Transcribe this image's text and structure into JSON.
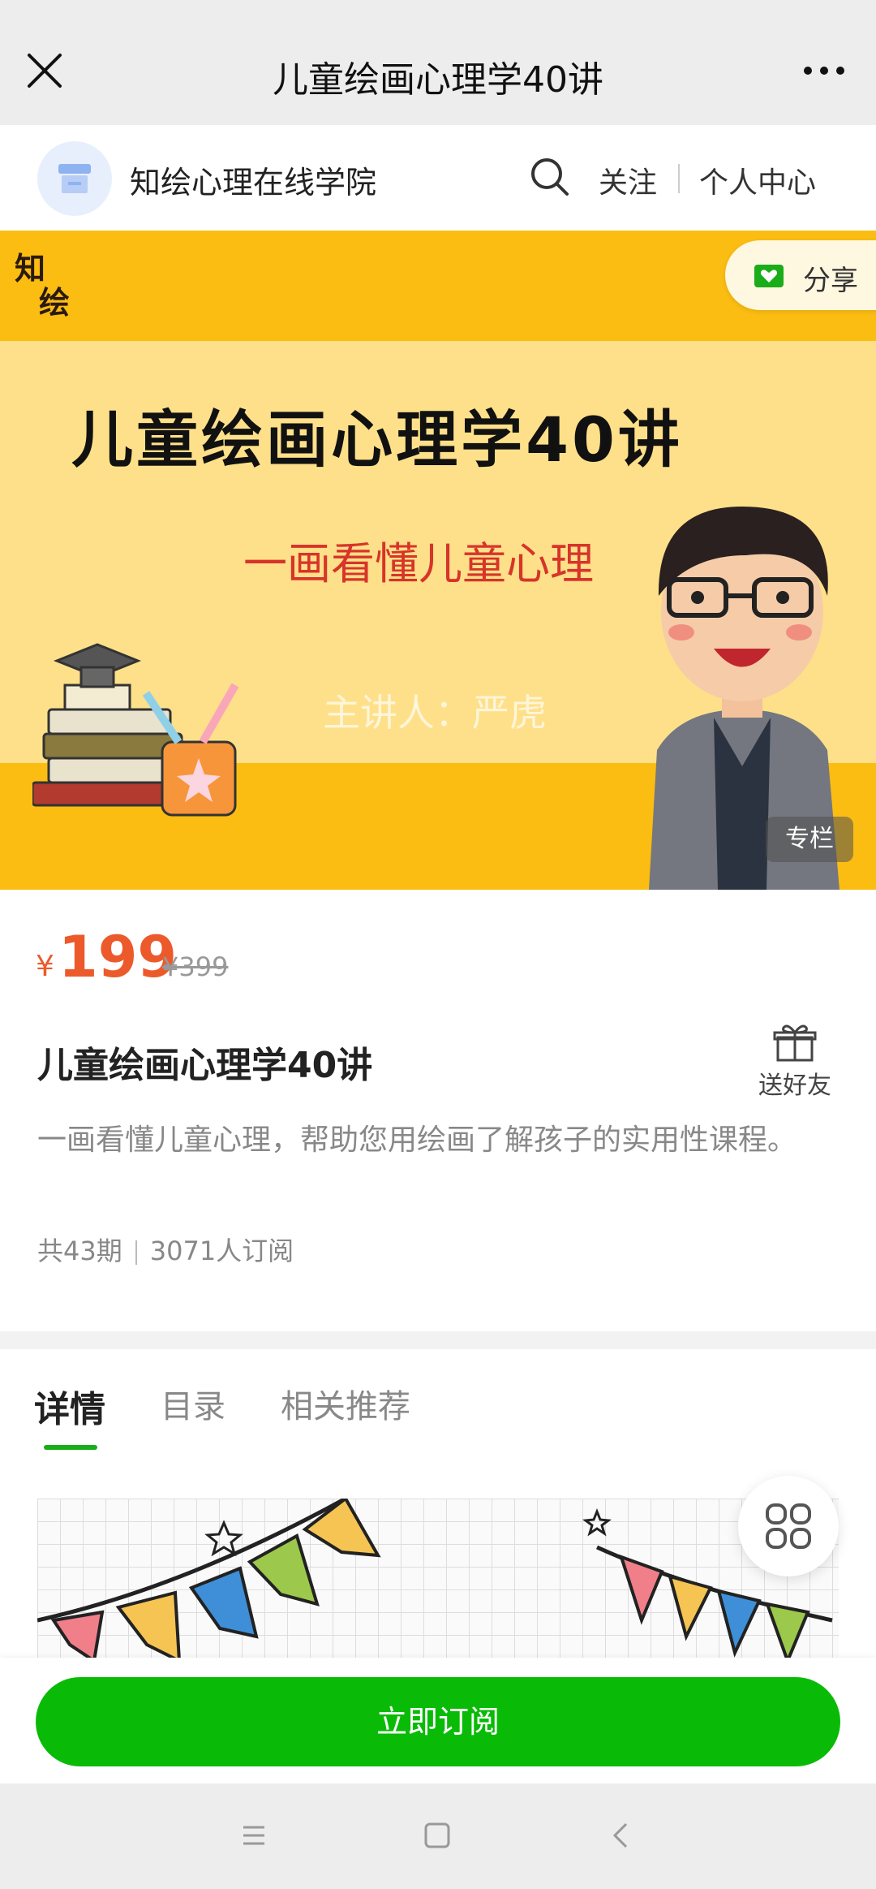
{
  "topbar": {
    "title": "儿童绘画心理学40讲"
  },
  "shop": {
    "name": "知绘心理在线学院",
    "follow": "关注",
    "center": "个人中心"
  },
  "banner": {
    "logo_line1": "知",
    "logo_line2": "绘",
    "share": "分享",
    "title": "儿童绘画心理学40讲",
    "subtitle": "一画看懂儿童心理",
    "lecturer": "主讲人：严虎",
    "column_tag": "专栏"
  },
  "product": {
    "currency": "¥",
    "price": "199",
    "original_price": "¥399",
    "title": "儿童绘画心理学40讲",
    "gift_label": "送好友",
    "description": "一画看懂儿童心理，帮助您用绘画了解孩子的实用性课程。",
    "episodes": "共43期",
    "subscribers": "3071人订阅"
  },
  "tabs": [
    {
      "label": "详情",
      "active": true
    },
    {
      "label": "目录",
      "active": false
    },
    {
      "label": "相关推荐",
      "active": false
    }
  ],
  "subscribe_button": "立即订阅",
  "colors": {
    "accent_green": "#09bb07",
    "price_orange": "#ec5a2c",
    "banner_yellow": "#fbbd12"
  }
}
